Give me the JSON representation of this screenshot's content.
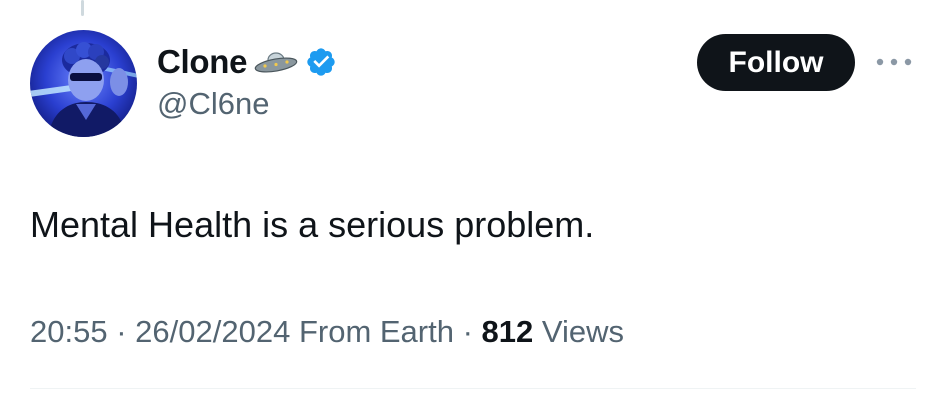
{
  "author": {
    "display_name": "Clone",
    "handle": "@Cl6ne",
    "name_emoji_icon": "ufo-icon",
    "verified_icon": "verified-badge-icon",
    "verified_color": "#1d9bf0"
  },
  "actions": {
    "follow_label": "Follow",
    "more_icon": "more-horizontal-icon"
  },
  "tweet": {
    "text": "Mental Health is a serious problem.",
    "time": "20:55",
    "separator": "·",
    "date": "26/02/2024",
    "source": "From Earth",
    "views_count": "812",
    "views_label": "Views"
  },
  "colors": {
    "text_primary": "#0f1419",
    "text_secondary": "#536471",
    "follow_bg": "#0f1419",
    "follow_text": "#ffffff",
    "avatar_tint": "#2c46d6"
  }
}
